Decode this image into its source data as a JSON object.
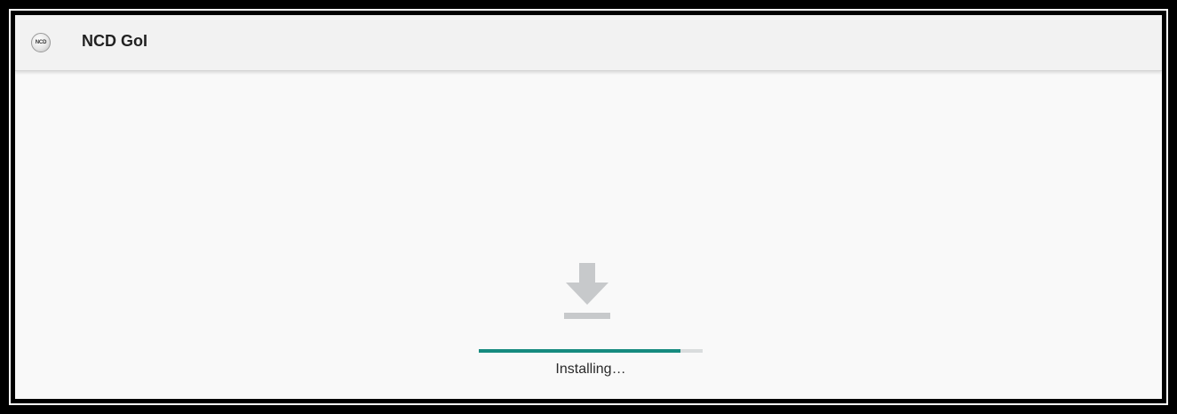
{
  "app": {
    "title": "NCD GoI",
    "icon_text": "NCD",
    "icon": "ncd-logo-icon"
  },
  "install": {
    "icon": "download-icon",
    "progress_fraction": 0.9,
    "status": "Installing…"
  },
  "colors": {
    "progress_fill": "#168b7f",
    "progress_track": "#d9dcdd",
    "icon_gray": "#c7c9cb",
    "background": "#f9f9f9",
    "titlebar": "#f2f2f2"
  }
}
